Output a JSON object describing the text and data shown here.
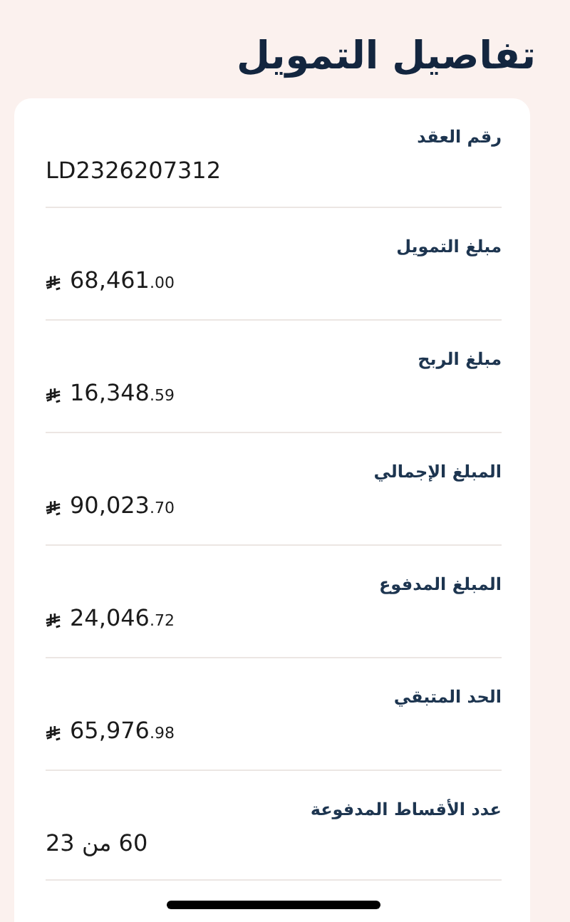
{
  "title": "تفاصيل التمويل",
  "details": [
    {
      "kind": "text",
      "label": "رقم العقد",
      "value": "LD2326207312"
    },
    {
      "kind": "amount",
      "label": "مبلغ التمويل",
      "whole": "68,461",
      "fraction": ".00"
    },
    {
      "kind": "amount",
      "label": "مبلغ الربح",
      "whole": "16,348",
      "fraction": ".59"
    },
    {
      "kind": "amount",
      "label": "المبلغ الإجمالي",
      "whole": "90,023",
      "fraction": ".70"
    },
    {
      "kind": "amount",
      "label": "المبلغ المدفوع",
      "whole": "24,046",
      "fraction": ".72"
    },
    {
      "kind": "amount",
      "label": "الحد المتبقي",
      "whole": "65,976",
      "fraction": ".98"
    },
    {
      "kind": "text",
      "label": "عدد الأقساط المدفوعة",
      "value": "23 من 60"
    }
  ]
}
